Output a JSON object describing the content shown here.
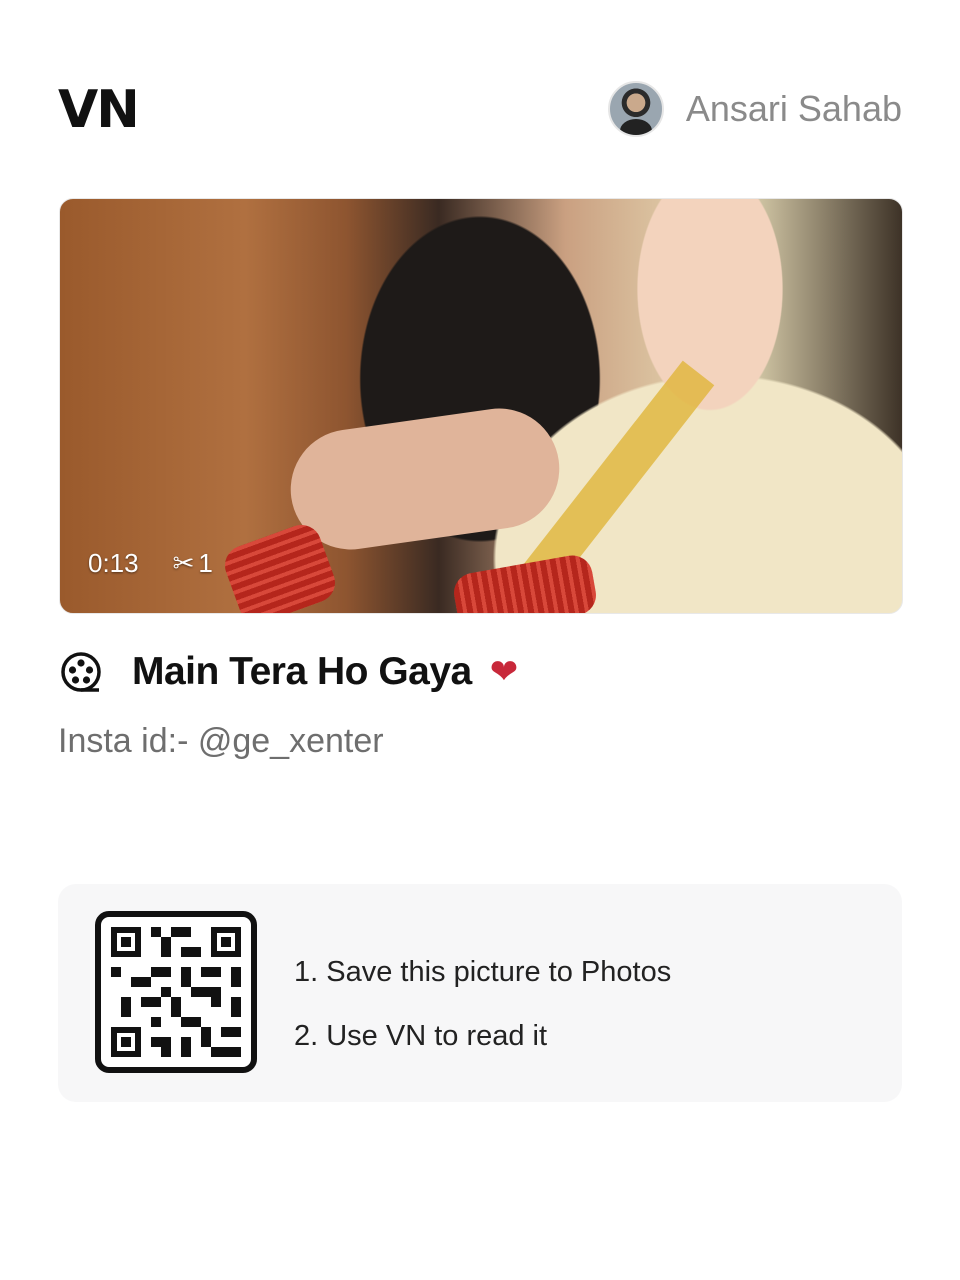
{
  "app": {
    "logo_text": "VN"
  },
  "user": {
    "name": "Ansari Sahab",
    "avatar_icon": "user-avatar"
  },
  "media": {
    "duration": "0:13",
    "clip_icon": "scissors-icon",
    "clip_count": "1"
  },
  "project": {
    "icon": "film-reel-icon",
    "title": "Main Tera Ho Gaya",
    "emoji": "anatomical-heart-icon",
    "subtitle": "Insta id:- @ge_xenter"
  },
  "qr_card": {
    "qr_icon": "qr-code",
    "steps": [
      "1. Save this picture to Photos",
      "2. Use VN to read it"
    ]
  },
  "colors": {
    "title": "#111111",
    "subtitle": "#6e6e6e",
    "username": "#8a8a8a",
    "card_bg": "#f7f7f8"
  }
}
